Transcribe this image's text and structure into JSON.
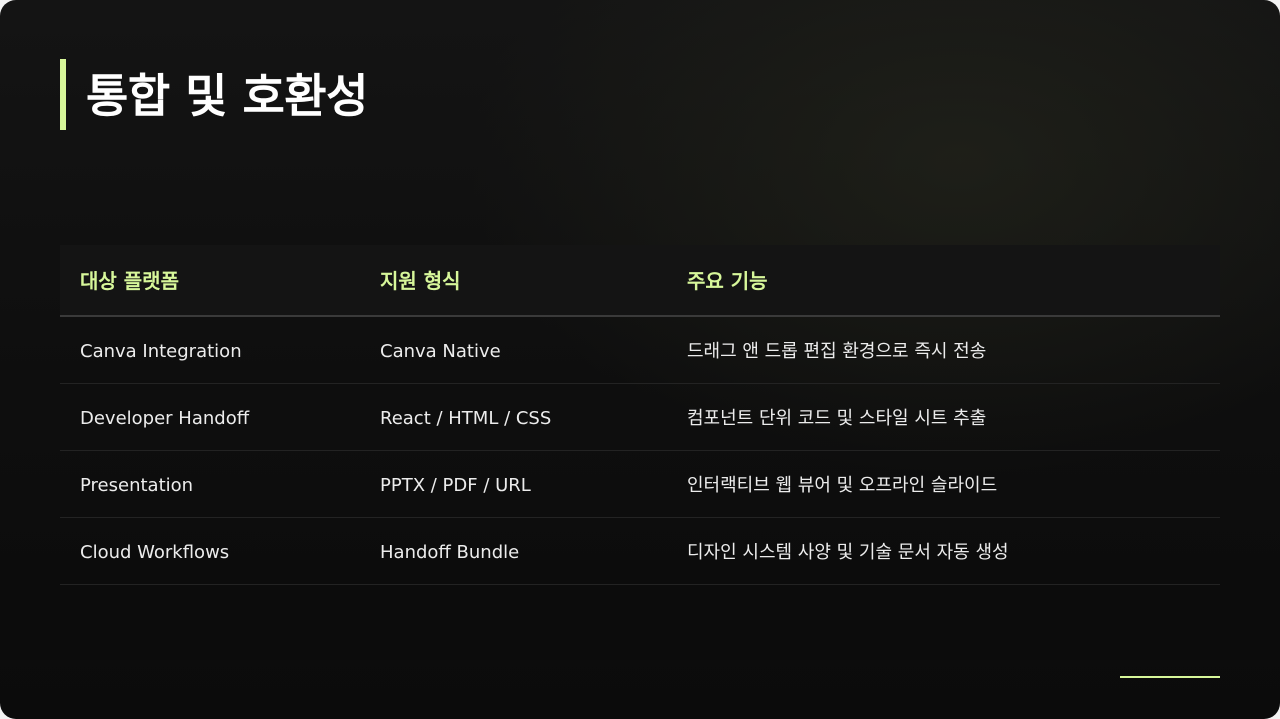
{
  "slide": {
    "title": "통합 및 호환성",
    "accent_color": "#d7f79a",
    "background_color": "#0e0e0e"
  },
  "table": {
    "headers": [
      "대상 플랫폼",
      "지원 형식",
      "주요 기능"
    ],
    "rows": [
      [
        "Canva Integration",
        "Canva Native",
        "드래그 앤 드롭 편집 환경으로 즉시 전송"
      ],
      [
        "Developer Handoff",
        "React / HTML / CSS",
        "컴포넌트 단위 코드 및 스타일 시트 추출"
      ],
      [
        "Presentation",
        "PPTX / PDF / URL",
        "인터랙티브 웹 뷰어 및 오프라인 슬라이드"
      ],
      [
        "Cloud Workflows",
        "Handoff Bundle",
        "디자인 시스템 사양 및 기술 문서 자동 생성"
      ]
    ]
  }
}
